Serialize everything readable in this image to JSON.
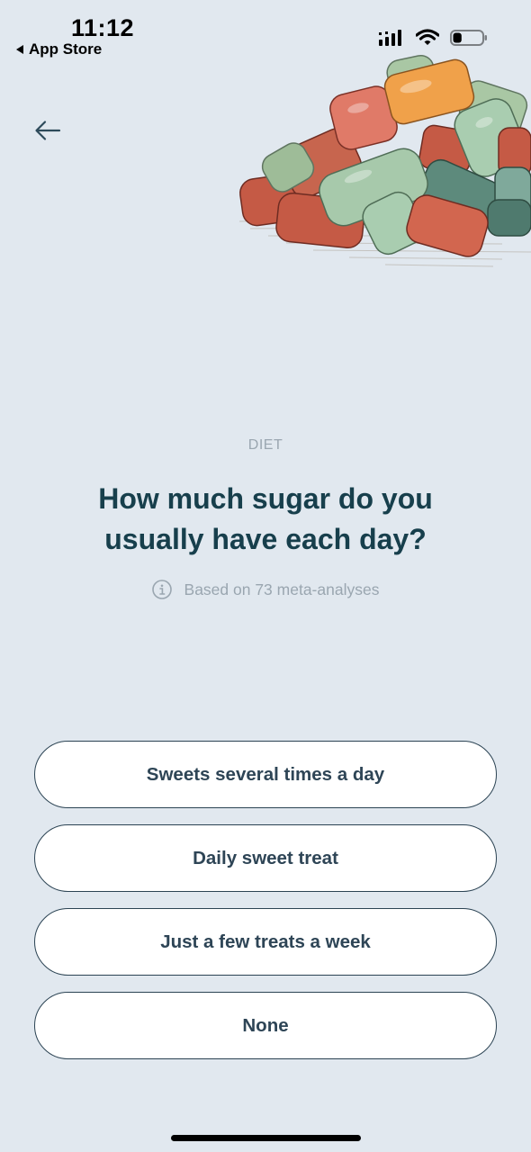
{
  "status_bar": {
    "time": "11:12",
    "back_app": "App Store",
    "battery_level": 0.3
  },
  "nav": {
    "back_icon": "arrow-left-icon"
  },
  "hero": {
    "image": "gummy-candies-illustration"
  },
  "question": {
    "category": "DIET",
    "text": "How much sugar do you usually have each day?",
    "source_icon": "info-icon",
    "source": "Based on 73 meta-analyses"
  },
  "answers": [
    {
      "label": "Sweets several times a day"
    },
    {
      "label": "Daily sweet treat"
    },
    {
      "label": "Just a few treats a week"
    },
    {
      "label": "None"
    }
  ],
  "colors": {
    "background": "#e1e8ef",
    "heading": "#173f4c",
    "muted": "#9aa6b0",
    "button_border": "#2b4353",
    "button_fill": "#ffffff"
  }
}
